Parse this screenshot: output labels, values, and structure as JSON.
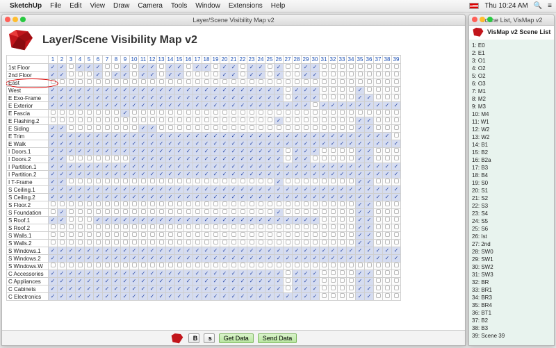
{
  "menubar": {
    "app": "SketchUp",
    "items": [
      "File",
      "Edit",
      "View",
      "Draw",
      "Camera",
      "Tools",
      "Window",
      "Extensions",
      "Help"
    ],
    "clock": "Thu 10:24 AM"
  },
  "left_window": {
    "title": "Layer/Scene Visibility Map v2",
    "heading": "Layer/Scene Visibility Map v2",
    "columns": [
      "1",
      "2",
      "3",
      "4",
      "5",
      "6",
      "7",
      "8",
      "9",
      "10",
      "11",
      "12",
      "13",
      "14",
      "15",
      "16",
      "17",
      "18",
      "19",
      "20",
      "21",
      "22",
      "23",
      "24",
      "25",
      "26",
      "27",
      "28",
      "29",
      "30",
      "31",
      "32",
      "33",
      "34",
      "35",
      "36",
      "37",
      "38",
      "39"
    ],
    "layers": [
      {
        "name": "1st Floor",
        "cells": "110111001011011011011011010011000000000"
      },
      {
        "name": "2nd Floor",
        "cells": "110001011011011000011011010011000000000"
      },
      {
        "name": "East",
        "cells": "000000000000000000000000000000000000000",
        "red_oval": true
      },
      {
        "name": "West",
        "cells": "111111111111111111111111110111000010000"
      },
      {
        "name": "E Exo-Frame",
        "cells": "111111111111111111111111110111000011000"
      },
      {
        "name": "E Exterior",
        "cells": "111111111111111111111111111110111111111"
      },
      {
        "name": "E Fascia",
        "cells": "000000001000000000000000000000000000000"
      },
      {
        "name": "E Flashing.2",
        "cells": "000000000000000000000000010000000011000"
      },
      {
        "name": "E Siding",
        "cells": "110000000011000000000000000000000011000"
      },
      {
        "name": "E Trim",
        "cells": "111111111111111111111111111111111111110"
      },
      {
        "name": "E Walk",
        "cells": "111111111111111111111111111111111111111"
      },
      {
        "name": "I Doors.1",
        "cells": "111111111111111111111111110111000011000"
      },
      {
        "name": "I Doors.2",
        "cells": "110000000111111111111111110110000011000"
      },
      {
        "name": "I Partition.1",
        "cells": "111111111111111111111111111111111111111"
      },
      {
        "name": "I Partition.2",
        "cells": "111111111111111111111111111111111111111"
      },
      {
        "name": "I T-Frame",
        "cells": "110000000000000000000000010000000011000"
      },
      {
        "name": "S Ceiling.1",
        "cells": "111111111111111111111111111111111111111"
      },
      {
        "name": "S Ceiling.2",
        "cells": "111111111111111111111111111111111111111"
      },
      {
        "name": "S Floor.2",
        "cells": "000000000000000000000000000000000011000"
      },
      {
        "name": "S Foundation",
        "cells": "010000000000000000000000010000000011000"
      },
      {
        "name": "S Roof.1",
        "cells": "110001111111111111111111111111000011000"
      },
      {
        "name": "S Roof.2",
        "cells": "000000000000000000000000000000000011000"
      },
      {
        "name": "S Walls.1",
        "cells": "000000000000000000000000000000000011000"
      },
      {
        "name": "S Walls.2",
        "cells": "000000000000000000000000000000000011000"
      },
      {
        "name": "S Windows.1",
        "cells": "111111111111111111111111111111111111111"
      },
      {
        "name": "S Windows.2",
        "cells": "111111111111111111111111111111111111111"
      },
      {
        "name": "S Windows.W",
        "cells": "000000000000000000000000000000000000000"
      },
      {
        "name": "C Accessories",
        "cells": "111111111111111111111111110111000011000"
      },
      {
        "name": "C Appliances",
        "cells": "111111111111111111111111110111000011000"
      },
      {
        "name": "C Cabinets",
        "cells": "111111111111111111111111110111000011000"
      },
      {
        "name": "C Electronics",
        "cells": "111111111111111111111111111111000011000"
      }
    ],
    "toolbar": {
      "b_label": "B",
      "s_label": "s",
      "get_data": "Get Data",
      "send_data": "Send Data"
    }
  },
  "right_window": {
    "title": "Scene List, VisMap v2",
    "heading": "VisMap v2 Scene List",
    "scenes": [
      "1: E0",
      "2: E1",
      "3: O1",
      "4: O2",
      "5: O2",
      "6: O3",
      "7: M1",
      "8: M2",
      "9: M3",
      "10: M4",
      "11: W1",
      "12: W2",
      "13: W2",
      "14: B1",
      "15: B2",
      "16: B2a",
      "17: B3",
      "18: B4",
      "19: S0",
      "20: S1",
      "21: S2",
      "22: S3",
      "23: S4",
      "24: S5",
      "25: S6",
      "26: Ist",
      "27: 2nd",
      "28: SW0",
      "29: SW1",
      "30: SW2",
      "31: SW3",
      "32: BR",
      "33: BR1",
      "34: BR3",
      "35: BR4",
      "36: BT1",
      "37: B2",
      "38: B3",
      "39: Scene 39"
    ]
  }
}
